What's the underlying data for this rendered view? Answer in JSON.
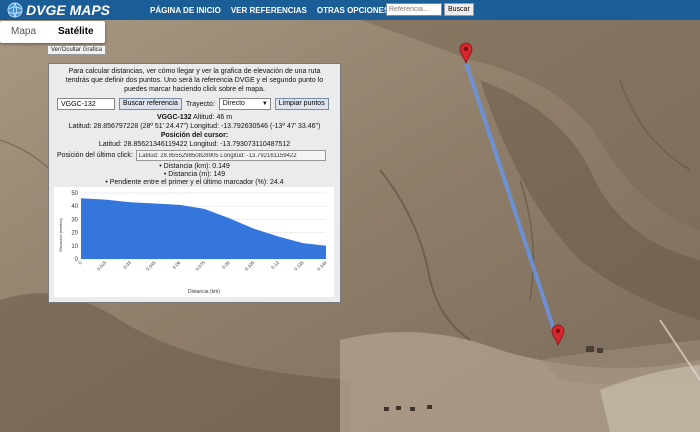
{
  "header": {
    "logo": "DVGE MAPS",
    "nav": [
      "PÁGINA DE INICIO",
      "VER REFERENCIAS",
      "OTRAS OPCIONES"
    ],
    "search_placeholder": "Referencia...",
    "search_button": "Buscar"
  },
  "map_type": {
    "map": "Mapa",
    "satellite": "Satélite"
  },
  "toggle_chart_label": "Ver/Ocultar Grafica",
  "panel": {
    "intro": "Para calcular distancias, ver cómo llegar y ver la grafica de elevación de una ruta tendrás que definir dos puntos. Uno será la referencia DVGE y el segundo punto lo puedes marcar haciendo click sobre el mapa.",
    "reference_value": "VGGC-132",
    "search_reference_button": "Buscar referencia",
    "route_label": "Trayecto:",
    "route_value": "Directo",
    "clear_button": "Limpiar puntos",
    "ref_name": "VGGC-132",
    "altitude": "Altitud: 46 m",
    "coords": "Latitud: 28.856797228 (28º 51' 24.47\") Longitud: -13.792630546 (-13º 47' 33.46\")",
    "cursor_title": "Posición del cursor:",
    "cursor_coords": "Latitud: 28.85621346119422 Longitud: -13.793073110487512",
    "last_click_label": "Posición del último click:",
    "last_click_value": "Latitud: 28.855529850828905 Longitud: -13.792161159422",
    "stats": [
      "Distancia (km): 0.149",
      "Distancia (m): 149",
      "Pendiente entre el primer y el último marcador (%): 24.4"
    ]
  },
  "colors": {
    "header": "#1b5d96",
    "route_line": "#6a94e0",
    "marker": "#d7262e",
    "chart_fill": "#2a6fdb"
  },
  "chart_data": {
    "type": "area",
    "xlabel": "Distancia (km)",
    "ylabel": "Elevación (metros)",
    "ylim": [
      0,
      50
    ],
    "yticks": [
      0,
      10,
      20,
      30,
      40,
      50
    ],
    "grid": true,
    "x": [
      0,
      0.015,
      0.03,
      0.045,
      0.06,
      0.075,
      0.09,
      0.105,
      0.12,
      0.135,
      0.149
    ],
    "xticks": [
      "0",
      "0.015",
      "0.03",
      "0.045",
      "0.06",
      "0.075",
      "0.09",
      "0.105",
      "0.12",
      "0.135",
      "0.149"
    ],
    "values": [
      46,
      45,
      43,
      42,
      41,
      38,
      31,
      23,
      17,
      12,
      10
    ]
  }
}
